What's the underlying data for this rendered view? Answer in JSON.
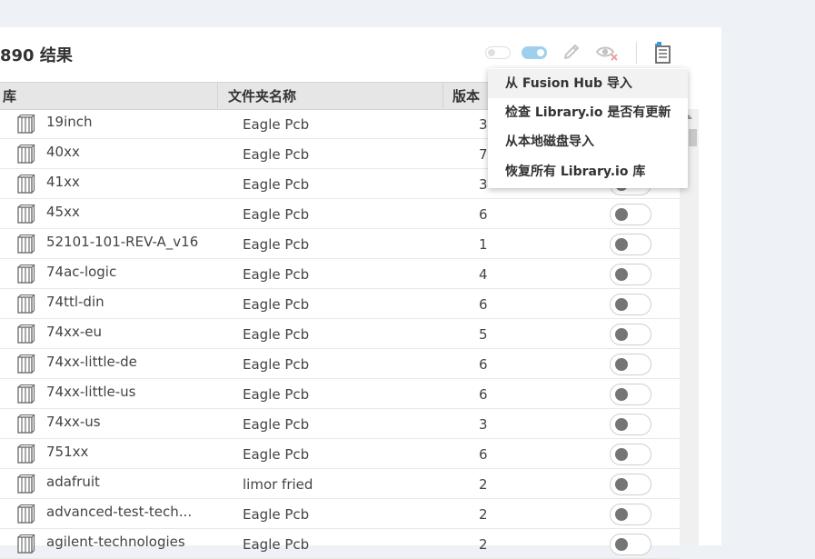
{
  "header": {
    "result_count": "890 结果"
  },
  "toolbar": {
    "icons": [
      "toggle-off",
      "toggle-on",
      "pencil-icon",
      "eye-off-icon",
      "import-icon"
    ]
  },
  "table": {
    "columns": [
      "库",
      "文件夹名称",
      "版本"
    ],
    "rows": [
      {
        "name": "19inch",
        "folder": "Eagle Pcb",
        "version": "3"
      },
      {
        "name": "40xx",
        "folder": "Eagle Pcb",
        "version": "7"
      },
      {
        "name": "41xx",
        "folder": "Eagle Pcb",
        "version": "3"
      },
      {
        "name": "45xx",
        "folder": "Eagle Pcb",
        "version": "6"
      },
      {
        "name": "52101-101-REV-A_v16",
        "folder": "Eagle Pcb",
        "version": "1"
      },
      {
        "name": "74ac-logic",
        "folder": "Eagle Pcb",
        "version": "4"
      },
      {
        "name": "74ttl-din",
        "folder": "Eagle Pcb",
        "version": "6"
      },
      {
        "name": "74xx-eu",
        "folder": "Eagle Pcb",
        "version": "5"
      },
      {
        "name": "74xx-little-de",
        "folder": "Eagle Pcb",
        "version": "6"
      },
      {
        "name": "74xx-little-us",
        "folder": "Eagle Pcb",
        "version": "6"
      },
      {
        "name": "74xx-us",
        "folder": "Eagle Pcb",
        "version": "3"
      },
      {
        "name": "751xx",
        "folder": "Eagle Pcb",
        "version": "6"
      },
      {
        "name": "adafruit",
        "folder": "limor fried",
        "version": "2"
      },
      {
        "name": "advanced-test-tech...",
        "folder": "Eagle Pcb",
        "version": "2"
      },
      {
        "name": "agilent-technologies",
        "folder": "Eagle Pcb",
        "version": "2"
      }
    ]
  },
  "menu": {
    "items": [
      "从 Fusion Hub 导入",
      "检查 Library.io 是否有更新",
      "从本地磁盘导入",
      "恢复所有 Library.io 库"
    ]
  }
}
